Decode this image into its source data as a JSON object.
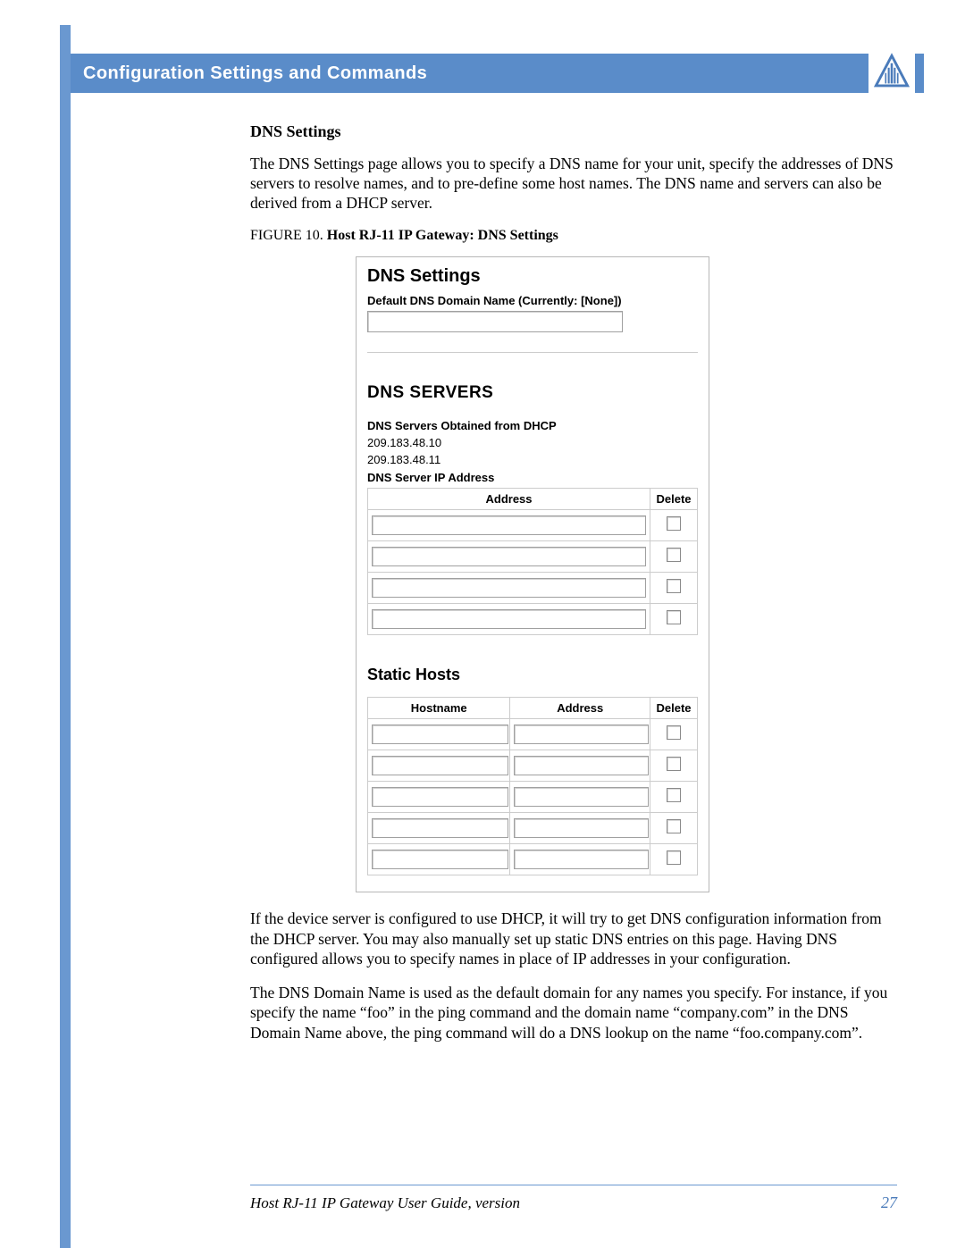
{
  "header": {
    "title": "Configuration Settings and Commands"
  },
  "section": {
    "title": "DNS Settings",
    "intro": "The DNS Settings page allows you to specify a DNS name for your unit, specify the addresses of DNS servers to resolve names, and to pre-define some host names. The DNS name and servers can also be derived from a DHCP server.",
    "figure_prefix": "FIGURE 10.  ",
    "figure_title": "Host RJ-11 IP Gateway: DNS Settings"
  },
  "screenshot": {
    "panel_title": "DNS Settings",
    "domain_label": "Default DNS Domain Name (Currently: [None])",
    "domain_value": "",
    "servers_heading": "DNS SERVERS",
    "dhcp_label": "DNS Servers Obtained from DHCP",
    "dhcp_servers": [
      "209.183.48.10",
      "209.183.48.11"
    ],
    "addr_label": "DNS Server IP Address",
    "addr_table": {
      "col_address": "Address",
      "col_delete": "Delete",
      "rows": [
        {
          "address": "",
          "delete": false
        },
        {
          "address": "",
          "delete": false
        },
        {
          "address": "",
          "delete": false
        },
        {
          "address": "",
          "delete": false
        }
      ]
    },
    "static_heading": "Static Hosts",
    "static_table": {
      "col_hostname": "Hostname",
      "col_address": "Address",
      "col_delete": "Delete",
      "rows": [
        {
          "hostname": "",
          "address": "",
          "delete": false
        },
        {
          "hostname": "",
          "address": "",
          "delete": false
        },
        {
          "hostname": "",
          "address": "",
          "delete": false
        },
        {
          "hostname": "",
          "address": "",
          "delete": false
        },
        {
          "hostname": "",
          "address": "",
          "delete": false
        }
      ]
    }
  },
  "body": {
    "p1": "If the device server is configured to use DHCP, it will try to get DNS configuration information from the DHCP server. You may also manually set up static DNS entries on this page. Having DNS configured allows you to specify names in place of IP addresses in your configuration.",
    "p2": "The DNS Domain Name is used as the default domain for any names you specify. For instance, if you specify the name “foo” in the ping command and the domain name “company.com” in the DNS Domain Name above, the ping command will do a DNS lookup on the name “foo.company.com”."
  },
  "footer": {
    "left": "Host RJ-11 IP Gateway User Guide, version",
    "page": "27"
  }
}
